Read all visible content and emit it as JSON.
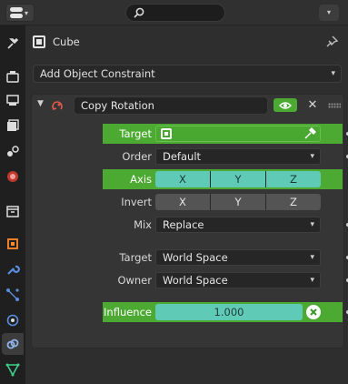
{
  "header": {
    "search_placeholder": ""
  },
  "tabs": [
    {
      "name": "tool-tab-icon",
      "active": false
    },
    {
      "name": "render-tab-icon",
      "active": false
    },
    {
      "name": "output-tab-icon",
      "active": false
    },
    {
      "name": "view-layer-tab-icon",
      "active": false
    },
    {
      "name": "scene-tab-icon",
      "active": false
    },
    {
      "name": "world-tab-icon",
      "active": false
    },
    {
      "name": "collection-tab-icon",
      "active": false
    },
    {
      "name": "object-tab-icon",
      "active": false
    },
    {
      "name": "modifier-tab-icon",
      "active": false
    },
    {
      "name": "particles-tab-icon",
      "active": false
    },
    {
      "name": "physics-tab-icon",
      "active": false
    },
    {
      "name": "object-constraint-tab-icon",
      "active": true
    },
    {
      "name": "object-data-tab-icon",
      "active": false
    }
  ],
  "context": {
    "object_name": "Cube"
  },
  "add_constraint": {
    "label": "Add Object Constraint"
  },
  "constraint": {
    "name": "Copy Rotation",
    "rows": {
      "target": {
        "label": "Target"
      },
      "order": {
        "label": "Order",
        "value": "Default"
      },
      "axis": {
        "label": "Axis",
        "x": "X",
        "y": "Y",
        "z": "Z"
      },
      "invert": {
        "label": "Invert",
        "x": "X",
        "y": "Y",
        "z": "Z"
      },
      "mix": {
        "label": "Mix",
        "value": "Replace"
      },
      "target_space": {
        "label": "Target",
        "value": "World Space"
      },
      "owner_space": {
        "label": "Owner",
        "value": "World Space"
      },
      "influence": {
        "label": "Influence",
        "value": "1.000"
      }
    }
  },
  "colors": {
    "accent_green": "#4caa32",
    "toggle_on": "#5fcbb6",
    "background": "#2e2e2e"
  }
}
